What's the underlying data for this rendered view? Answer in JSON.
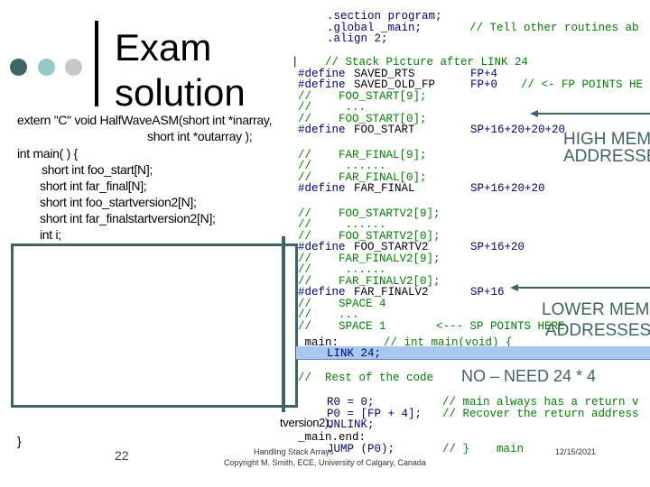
{
  "slide": {
    "title_line1": "Exam",
    "title_line2": "solution",
    "decor_dot_colors": [
      "#3f6464",
      "#96c8c8",
      "#c8c8c8"
    ],
    "accent_color": "#3f6464",
    "highlight_color": "#a8c8f0"
  },
  "c_code": {
    "lines": [
      "extern \"C\" void HalfWaveASM(short int *inarray,",
      "short int *outarray );",
      "int main( ) {",
      "short int foo_start[N];",
      "short int far_final[N];",
      "short int foo_startversion2[N];",
      "short int far_finalstartversion2[N];",
      "int i;",
      "}"
    ],
    "partial_visible": "tversion2);"
  },
  "asm_code": {
    "header": [
      {
        "code": ".section program;",
        "comment": ""
      },
      {
        "code": ".global _main;",
        "comment": "// Tell other routines ab"
      },
      {
        "code": ".align 2;",
        "comment": ""
      }
    ],
    "stack_comment": "// Stack Picture after LINK 24",
    "lines": [
      {
        "kw": "#define",
        "name": "SAVED_RTS",
        "value": "FP+4",
        "comment": ""
      },
      {
        "kw": "#define",
        "name": "SAVED_OLD_FP",
        "value": "FP+0",
        "comment": "// <- FP POINTS HE"
      },
      {
        "comment": "//    FOO_START[9];"
      },
      {
        "comment": "//     ..."
      },
      {
        "comment": "//    FOO_START[0];"
      },
      {
        "kw": "#define",
        "name": "FOO_START",
        "value": "SP+16+20+20+20"
      },
      {
        "comment": "//    FAR_FINAL[9];"
      },
      {
        "comment": "//     ......"
      },
      {
        "comment": "//    FAR_FINAL[0];"
      },
      {
        "kw": "#define",
        "name": "FAR_FINAL",
        "value": "SP+16+20+20"
      },
      {
        "comment": "//    FOO_STARTV2[9];"
      },
      {
        "comment": "//     ......"
      },
      {
        "comment": "//    FOO_STARTV2[0];"
      },
      {
        "kw": "#define",
        "name": "FOO_STARTV2",
        "value": "SP+16+20"
      },
      {
        "comment": "//    FAR_FINALV2[9];"
      },
      {
        "comment": "//     ......"
      },
      {
        "comment": "//    FAR_FINALV2[0];"
      },
      {
        "kw": "#define",
        "name": "FAR_FINALV2",
        "value": "SP+16"
      },
      {
        "comment": "//    SPACE 4"
      },
      {
        "comment": "//    ..."
      },
      {
        "comment": "//    SPACE 1",
        "trail": "<--- SP POINTS HERE"
      }
    ],
    "main_label": "_main:",
    "main_comment": "// int main(void) {",
    "link_line": "LINK 24;",
    "rest_comment": "//  Rest of the code",
    "r0_line": "R0 = 0;",
    "r0_comment": "// main always has a return v",
    "p0_line": "P0 = [FP + 4];",
    "p0_comment": "// Recover the return address",
    "unlink_line": "UNLINK;",
    "main_end": "_main.end:",
    "jump_line": "JUMP (P0);",
    "jump_comment": "// }    main"
  },
  "annotations": {
    "high_memory_1": "HIGH MEMO",
    "high_memory_2": "ADDRESSE",
    "lower_memory_1": "LOWER MEMO",
    "lower_memory_2": "ADDRESSES",
    "need_note": "NO – NEED 24 * 4"
  },
  "footer": {
    "page_number": "22",
    "title": "Handling Stack Arrays",
    "copyright": "Copyright M. Smith, ECE, University of Calgary, Canada",
    "date": "12/15/2021"
  }
}
